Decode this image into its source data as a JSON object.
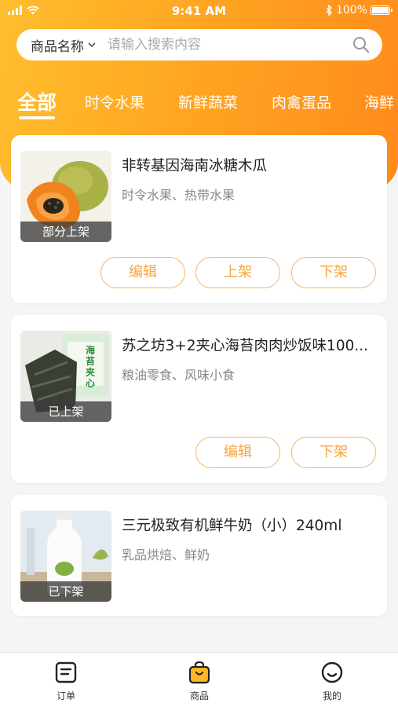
{
  "status": {
    "time": "9:41 AM",
    "battery": "100%"
  },
  "search": {
    "category": "商品名称",
    "placeholder": "请输入搜索内容"
  },
  "tabs": [
    "全部",
    "时令水果",
    "新鲜蔬菜",
    "肉禽蛋品",
    "海鲜"
  ],
  "products": [
    {
      "title": "非转基因海南冰糖木瓜",
      "categories": "时令水果、热带水果",
      "badge": "部分上架",
      "actions": [
        "编辑",
        "上架",
        "下架"
      ]
    },
    {
      "title": "苏之坊3+2夹心海苔肉肉炒饭味100...",
      "categories": "粮油零食、风味小食",
      "badge": "已上架",
      "actions": [
        "编辑",
        "下架"
      ]
    },
    {
      "title": "三元极致有机鲜牛奶（小）240ml",
      "categories": "乳品烘焙、鲜奶",
      "badge": "已下架",
      "actions": []
    }
  ],
  "product_image_text": {
    "seaweed_package": "海苔夹心"
  },
  "tabbar": {
    "items": [
      "订单",
      "商品",
      "我的"
    ],
    "active": "商品"
  },
  "colors": {
    "accent": "#ff9f1c",
    "button_text": "#f7a53e",
    "button_border": "#f8b46a"
  }
}
